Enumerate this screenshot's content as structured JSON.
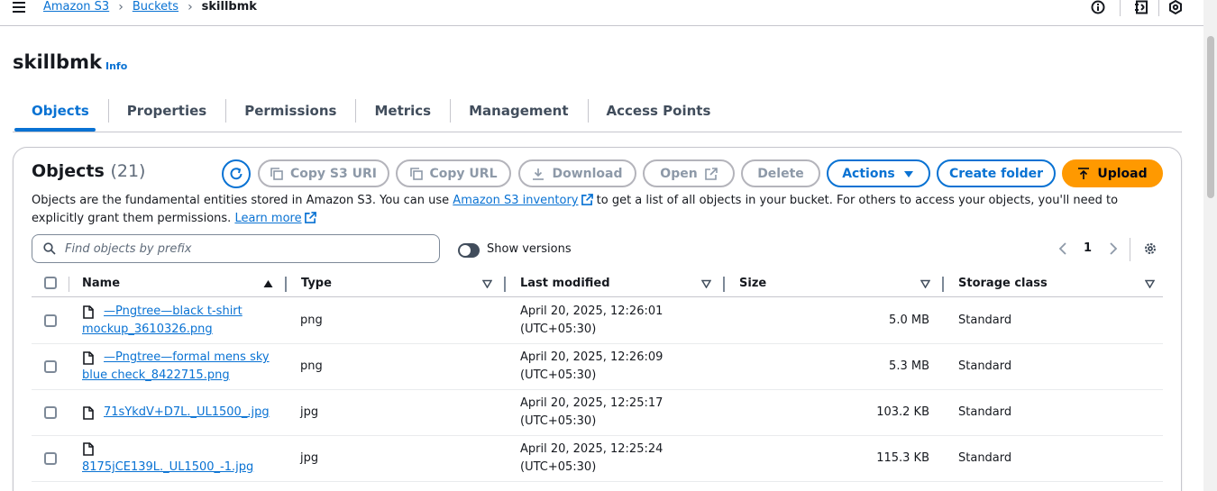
{
  "breadcrumb": {
    "items": [
      "Amazon S3",
      "Buckets"
    ],
    "current": "skillbmk"
  },
  "header": {
    "title": "skillbmk",
    "info": "Info"
  },
  "tabs": [
    "Objects",
    "Properties",
    "Permissions",
    "Metrics",
    "Management",
    "Access Points"
  ],
  "objects": {
    "title": "Objects",
    "count": "(21)",
    "buttons": {
      "copy_uri": "Copy S3 URI",
      "copy_url": "Copy URL",
      "download": "Download",
      "open": "Open",
      "delete": "Delete",
      "actions": "Actions",
      "create_folder": "Create folder",
      "upload": "Upload"
    },
    "description": {
      "before": "Objects are the fundamental entities stored in Amazon S3. You can use ",
      "inventory_link": "Amazon S3 inventory",
      "after": " to get a list of all objects in your bucket. For others to access your objects, you'll need to explicitly grant them permissions. ",
      "learn_more": "Learn more"
    },
    "search_placeholder": "Find objects by prefix",
    "show_versions": "Show versions",
    "page": "1"
  },
  "table": {
    "columns": [
      "Name",
      "Type",
      "Last modified",
      "Size",
      "Storage class"
    ],
    "rows": [
      {
        "name_line1": "—Pngtree—black t-shirt",
        "name_line2": "mockup_3610326.png",
        "type": "png",
        "modified_line1": "April 20, 2025, 12:26:01",
        "modified_line2": "(UTC+05:30)",
        "size": "5.0 MB",
        "storage": "Standard"
      },
      {
        "name_line1": "—Pngtree—formal mens sky",
        "name_line2": "blue check_8422715.png",
        "type": "png",
        "modified_line1": "April 20, 2025, 12:26:09",
        "modified_line2": "(UTC+05:30)",
        "size": "5.3 MB",
        "storage": "Standard"
      },
      {
        "name_line1": "71sYkdV+D7L._UL1500_.jpg",
        "name_line2": "",
        "type": "jpg",
        "modified_line1": "April 20, 2025, 12:25:17",
        "modified_line2": "(UTC+05:30)",
        "size": "103.2 KB",
        "storage": "Standard"
      },
      {
        "name_line1": "",
        "name_line2": "8175jCE139L._UL1500_-1.jpg",
        "type": "jpg",
        "modified_line1": "April 20, 2025, 12:25:24",
        "modified_line2": "(UTC+05:30)",
        "size": "115.3 KB",
        "storage": "Standard"
      }
    ]
  }
}
